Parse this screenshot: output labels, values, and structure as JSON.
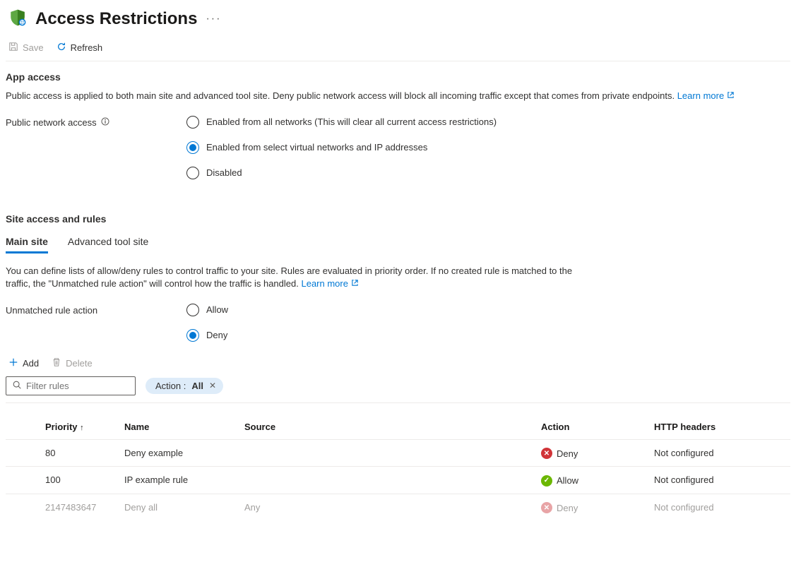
{
  "page": {
    "title": "Access Restrictions",
    "more_label": "···"
  },
  "toolbar": {
    "save_label": "Save",
    "refresh_label": "Refresh"
  },
  "app_access": {
    "section_title": "App access",
    "description": "Public access is applied to both main site and advanced tool site. Deny public network access will block all incoming traffic except that comes from private endpoints.",
    "learn_more_label": "Learn more",
    "field_label": "Public network access",
    "options": [
      "Enabled from all networks (This will clear all current access restrictions)",
      "Enabled from select virtual networks and IP addresses",
      "Disabled"
    ],
    "selected_index": 1
  },
  "site_access": {
    "section_title": "Site access and rules",
    "tabs": [
      "Main site",
      "Advanced tool site"
    ],
    "active_tab_index": 0,
    "description": "You can define lists of allow/deny rules to control traffic to your site. Rules are evaluated in priority order. If no created rule is matched to the traffic, the \"Unmatched rule action\" will control how the traffic is handled.",
    "learn_more_label": "Learn more",
    "unmatched_label": "Unmatched rule action",
    "unmatched_options": [
      "Allow",
      "Deny"
    ],
    "unmatched_selected_index": 1
  },
  "rules_toolbar": {
    "add_label": "Add",
    "delete_label": "Delete"
  },
  "filter": {
    "placeholder": "Filter rules",
    "pill_key": "Action :",
    "pill_value": "All"
  },
  "table": {
    "columns": {
      "priority": "Priority",
      "name": "Name",
      "source": "Source",
      "action": "Action",
      "http_headers": "HTTP headers"
    },
    "rows": [
      {
        "priority": "80",
        "name": "Deny example",
        "source": "",
        "action": "Deny",
        "http_headers": "Not configured",
        "muted": false
      },
      {
        "priority": "100",
        "name": "IP example rule",
        "source": "",
        "action": "Allow",
        "http_headers": "Not configured",
        "muted": false
      },
      {
        "priority": "2147483647",
        "name": "Deny all",
        "source": "Any",
        "action": "Deny",
        "http_headers": "Not configured",
        "muted": true
      }
    ]
  }
}
